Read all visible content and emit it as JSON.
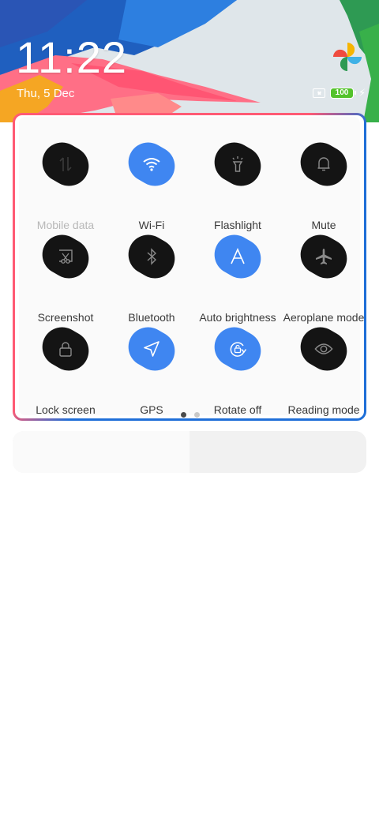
{
  "status_bar": {
    "time": "11:22",
    "date": "Thu, 5 Dec",
    "battery_level": "100",
    "charging": true,
    "icons": [
      "no-sim-icon",
      "battery-icon",
      "charging-bolt-icon"
    ],
    "app_icon": "pinwheel-icon"
  },
  "quick_settings": {
    "accent_color": "#3f86f1",
    "off_color": "#141414",
    "tiles": [
      {
        "label": "Mobile data",
        "icon": "mobile-data-icon",
        "state": "disabled"
      },
      {
        "label": "Wi-Fi",
        "icon": "wifi-icon",
        "state": "on"
      },
      {
        "label": "Flashlight",
        "icon": "flashlight-icon",
        "state": "off"
      },
      {
        "label": "Mute",
        "icon": "bell-icon",
        "state": "off"
      },
      {
        "label": "Screenshot",
        "icon": "screenshot-icon",
        "state": "off"
      },
      {
        "label": "Bluetooth",
        "icon": "bluetooth-icon",
        "state": "off"
      },
      {
        "label": "Auto brightness",
        "icon": "auto-brightness-icon",
        "state": "on"
      },
      {
        "label": "Aeroplane mode",
        "icon": "airplane-icon",
        "state": "off"
      },
      {
        "label": "Lock screen",
        "icon": "lock-icon",
        "state": "off"
      },
      {
        "label": "GPS",
        "icon": "gps-icon",
        "state": "on"
      },
      {
        "label": "Rotate off",
        "icon": "rotate-lock-icon",
        "state": "on"
      },
      {
        "label": "Reading mode",
        "icon": "eye-icon",
        "state": "off"
      }
    ],
    "pages": {
      "current": 1,
      "total": 2
    }
  },
  "brightness": {
    "level_fraction": 0.5
  }
}
